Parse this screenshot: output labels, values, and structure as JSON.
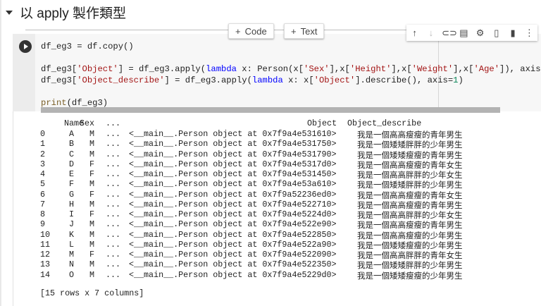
{
  "section": {
    "title": "以 apply 製作類型"
  },
  "add_buttons": {
    "code": "Code",
    "text": "Text"
  },
  "code_lines": {
    "l1": "df_eg3 = df.copy()",
    "l2a": "df_eg3[",
    "l2s1": "'Object'",
    "l2b": "] = df_eg3.apply(",
    "l2kw": "lambda",
    "l2c": " x: Person(x[",
    "l2s2": "'Sex'",
    "l2d": "],x[",
    "l2s3": "'Height'",
    "l2e": "],x[",
    "l2s4": "'Weight'",
    "l2f": "],x[",
    "l2s5": "'Age'",
    "l2g": "]), axis=",
    "l2n": "1",
    "l2h": ")",
    "l3a": "df_eg3[",
    "l3s1": "'Object_describe'",
    "l3b": "] = df_eg3.apply(",
    "l3kw": "lambda",
    "l3c": " x: x[",
    "l3s2": "'Object'",
    "l3d": "].describe(), axis=",
    "l3n": "1",
    "l3e": ")",
    "l4fn": "print",
    "l4a": "(df_eg3)"
  },
  "output": {
    "headers": {
      "name": "Name",
      "sex": "Sex",
      "ellipsis": "...",
      "object": "Object",
      "describe": "Object_describe"
    },
    "rows": [
      [
        "0",
        "A",
        "M",
        "...",
        "<__main__.Person object at 0x7f9a4e531610>",
        "我是一個高高瘦瘦的青年男生"
      ],
      [
        "1",
        "B",
        "M",
        "...",
        "<__main__.Person object at 0x7f9a4e531750>",
        "我是一個矮矮胖胖的少年男生"
      ],
      [
        "2",
        "C",
        "M",
        "...",
        "<__main__.Person object at 0x7f9a4e531790>",
        "我是一個矮矮瘦瘦的青年男生"
      ],
      [
        "3",
        "D",
        "F",
        "...",
        "<__main__.Person object at 0x7f9a4e5317d0>",
        "我是一個高高瘦瘦的青年女生"
      ],
      [
        "4",
        "E",
        "F",
        "...",
        "<__main__.Person object at 0x7f9a4e531450>",
        "我是一個高高胖胖的少年女生"
      ],
      [
        "5",
        "F",
        "M",
        "...",
        "<__main__.Person object at 0x7f9a4e53a610>",
        "我是一個矮矮胖胖的少年男生"
      ],
      [
        "6",
        "G",
        "F",
        "...",
        "<__main__.Person object at 0x7f9a52236ed0>",
        "我是一個高高瘦瘦的青年女生"
      ],
      [
        "7",
        "H",
        "M",
        "...",
        "<__main__.Person object at 0x7f9a4e522710>",
        "我是一個高高瘦瘦的青年男生"
      ],
      [
        "8",
        "I",
        "F",
        "...",
        "<__main__.Person object at 0x7f9a4e5224d0>",
        "我是一個高高胖胖的少年女生"
      ],
      [
        "9",
        "J",
        "M",
        "...",
        "<__main__.Person object at 0x7f9a4e522e90>",
        "我是一個高高瘦瘦的青年男生"
      ],
      [
        "10",
        "K",
        "M",
        "...",
        "<__main__.Person object at 0x7f9a4e522850>",
        "我是一個高高瘦瘦的少年男生"
      ],
      [
        "11",
        "L",
        "M",
        "...",
        "<__main__.Person object at 0x7f9a4e522a90>",
        "我是一個矮矮瘦瘦的少年男生"
      ],
      [
        "12",
        "M",
        "F",
        "...",
        "<__main__.Person object at 0x7f9a4e522090>",
        "我是一個高高胖胖的青年女生"
      ],
      [
        "13",
        "N",
        "M",
        "...",
        "<__main__.Person object at 0x7f9a4e522350>",
        "我是一個矮矮胖胖的少年男生"
      ],
      [
        "14",
        "O",
        "M",
        "...",
        "<__main__.Person object at 0x7f9a4e5229d0>",
        "我是一個矮矮瘦瘦的少年男生"
      ]
    ],
    "footer": "[15 rows x 7 columns]"
  }
}
